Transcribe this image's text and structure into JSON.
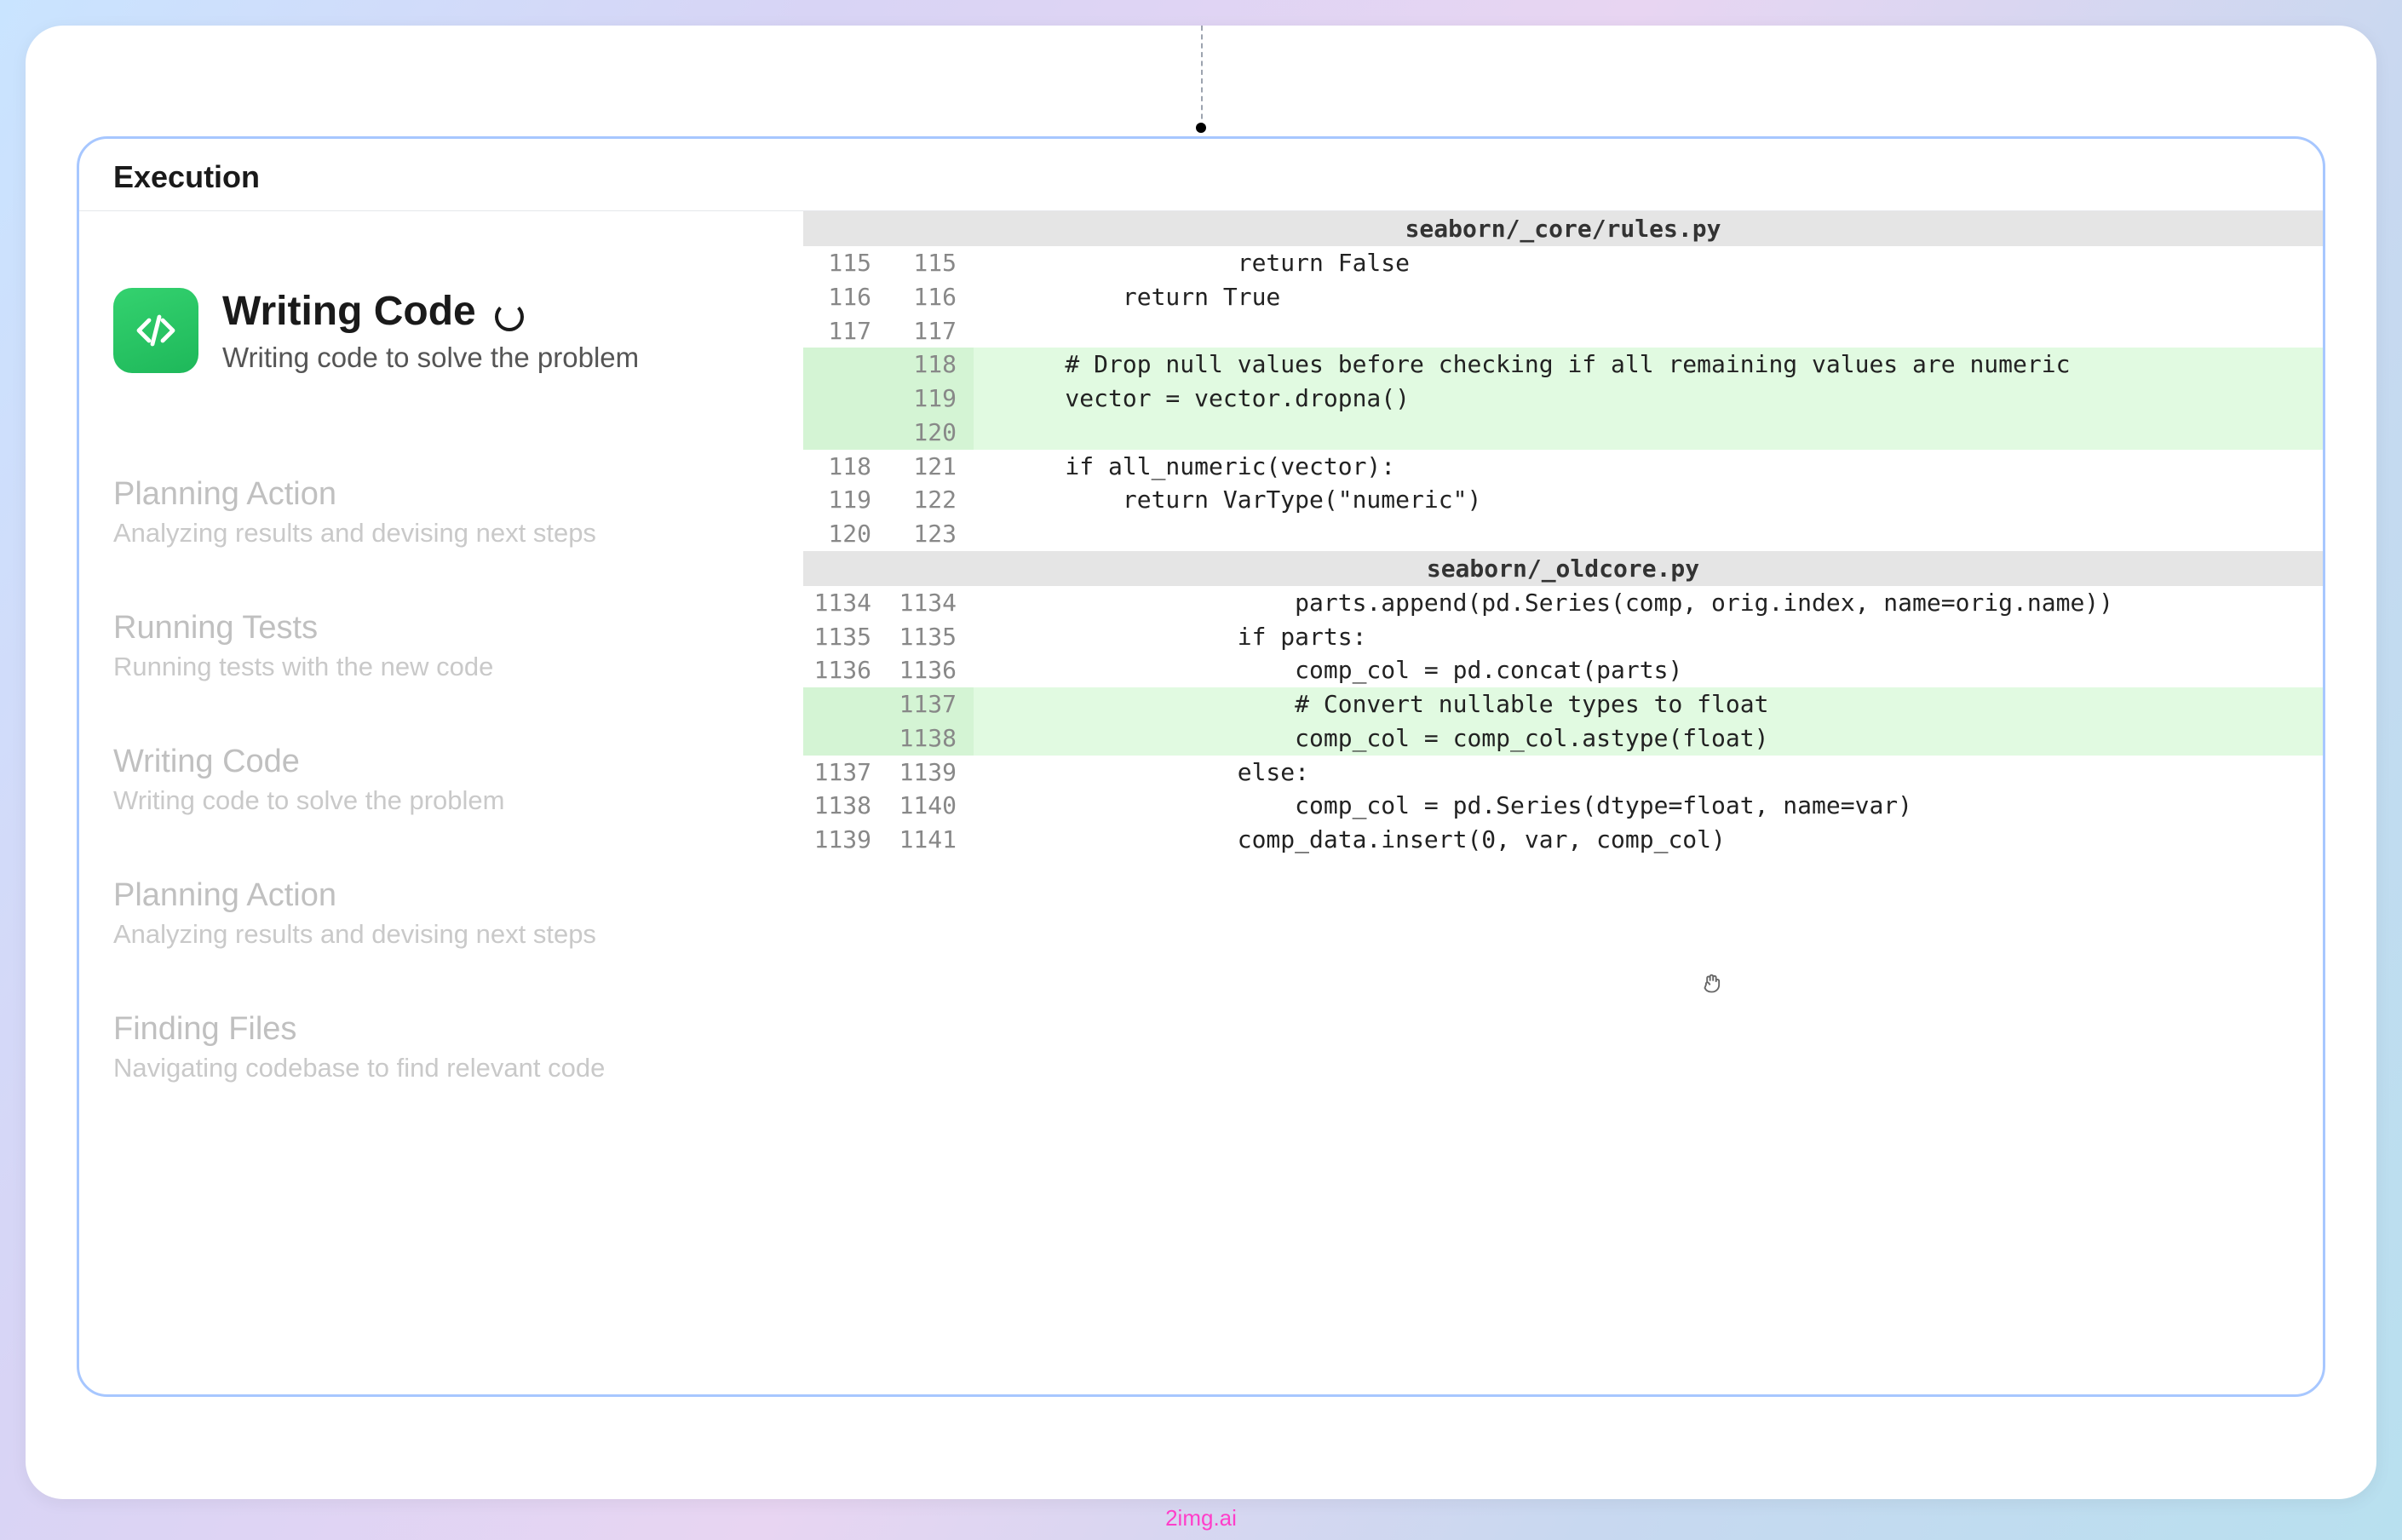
{
  "panel": {
    "title": "Execution"
  },
  "current_step": {
    "icon": "code-icon",
    "title": "Writing Code",
    "subtitle": "Writing code to solve the problem"
  },
  "history": [
    {
      "title": "Planning Action",
      "subtitle": "Analyzing results and devising next steps"
    },
    {
      "title": "Running Tests",
      "subtitle": "Running tests with the new code"
    },
    {
      "title": "Writing Code",
      "subtitle": "Writing code to solve the problem"
    },
    {
      "title": "Planning Action",
      "subtitle": "Analyzing results and devising next steps"
    },
    {
      "title": "Finding Files",
      "subtitle": "Navigating codebase to find relevant code"
    }
  ],
  "diff": {
    "files": [
      {
        "path": "seaborn/_core/rules.py",
        "lines": [
          {
            "old": "115",
            "new": "115",
            "added": false,
            "text": "                return False"
          },
          {
            "old": "116",
            "new": "116",
            "added": false,
            "text": "        return True"
          },
          {
            "old": "117",
            "new": "117",
            "added": false,
            "text": ""
          },
          {
            "old": "",
            "new": "118",
            "added": true,
            "text": "    # Drop null values before checking if all remaining values are numeric"
          },
          {
            "old": "",
            "new": "119",
            "added": true,
            "text": "    vector = vector.dropna()"
          },
          {
            "old": "",
            "new": "120",
            "added": true,
            "text": ""
          },
          {
            "old": "118",
            "new": "121",
            "added": false,
            "text": "    if all_numeric(vector):"
          },
          {
            "old": "119",
            "new": "122",
            "added": false,
            "text": "        return VarType(\"numeric\")"
          },
          {
            "old": "120",
            "new": "123",
            "added": false,
            "text": ""
          }
        ]
      },
      {
        "path": "seaborn/_oldcore.py",
        "lines": [
          {
            "old": "1134",
            "new": "1134",
            "added": false,
            "text": "                    parts.append(pd.Series(comp, orig.index, name=orig.name))"
          },
          {
            "old": "1135",
            "new": "1135",
            "added": false,
            "text": "                if parts:"
          },
          {
            "old": "1136",
            "new": "1136",
            "added": false,
            "text": "                    comp_col = pd.concat(parts)"
          },
          {
            "old": "",
            "new": "1137",
            "added": true,
            "text": "                    # Convert nullable types to float"
          },
          {
            "old": "",
            "new": "1138",
            "added": true,
            "text": "                    comp_col = comp_col.astype(float)"
          },
          {
            "old": "1137",
            "new": "1139",
            "added": false,
            "text": "                else:"
          },
          {
            "old": "1138",
            "new": "1140",
            "added": false,
            "text": "                    comp_col = pd.Series(dtype=float, name=var)"
          },
          {
            "old": "1139",
            "new": "1141",
            "added": false,
            "text": "                comp_data.insert(0, var, comp_col)"
          }
        ]
      }
    ]
  },
  "watermark": "2img.ai"
}
